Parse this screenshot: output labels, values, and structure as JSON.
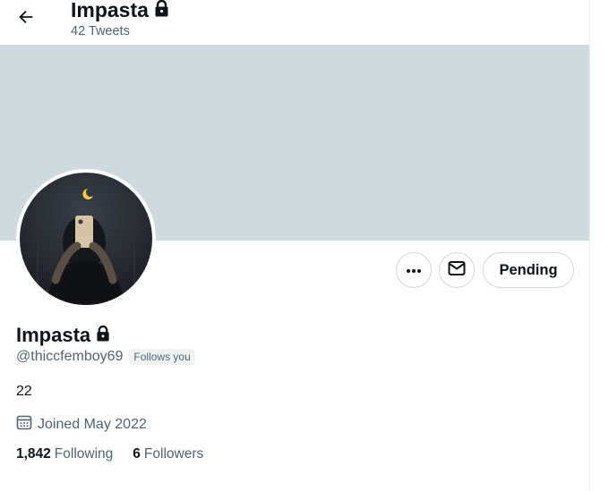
{
  "header": {
    "title": "Impasta",
    "tweet_count": "42 Tweets",
    "back_icon": "arrow-left-icon",
    "lock_icon": "lock-icon"
  },
  "banner": {
    "color": "#cfd9de"
  },
  "actions": {
    "more_icon": "more-dots-icon",
    "message_icon": "envelope-icon",
    "pending_label": "Pending"
  },
  "profile": {
    "name": "Impasta",
    "handle": "@thiccfemboy69",
    "follows_you": "Follows you",
    "bio": "22",
    "joined": "Joined May 2022",
    "joined_icon": "calendar-icon",
    "following_count": "1,842",
    "following_label": "Following",
    "followers_count": "6",
    "followers_label": "Followers"
  },
  "colors": {
    "text_primary": "#0f1419",
    "text_secondary": "#536471",
    "border": "#cfd9de"
  }
}
